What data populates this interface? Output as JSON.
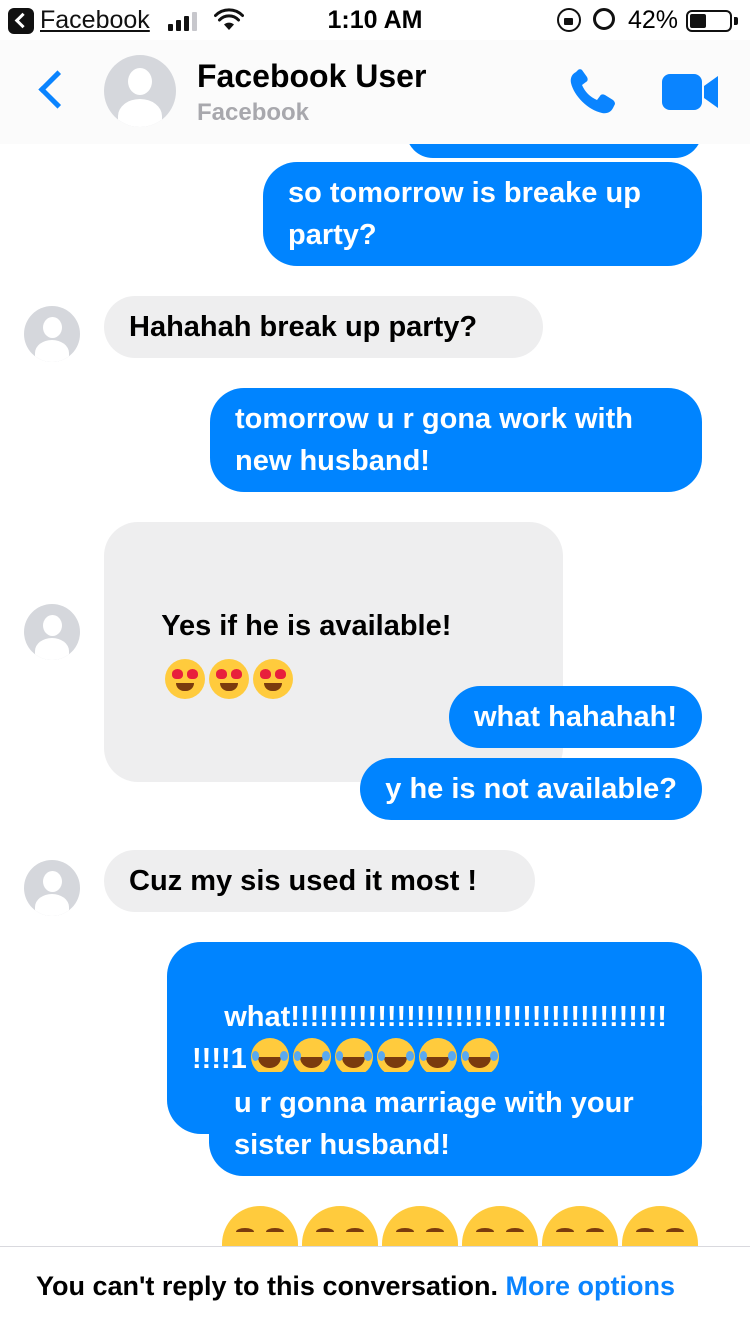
{
  "status_bar": {
    "back_app": "Facebook",
    "time": "1:10 AM",
    "battery_percent": "42%",
    "battery_level": 0.42,
    "signal_bars": 3,
    "icons": [
      "signal-icon",
      "wifi-icon",
      "orientation-lock-icon",
      "alarm-icon",
      "battery-icon"
    ]
  },
  "header": {
    "contact_name": "Facebook User",
    "contact_subtitle": "Facebook",
    "icons": [
      "back-chevron-icon",
      "avatar-icon",
      "phone-icon",
      "video-camera-icon"
    ],
    "accent_color": "#0a84ff"
  },
  "messages": [
    {
      "direction": "outgoing",
      "text": "so tomorrow is breake up\nparty?"
    },
    {
      "direction": "incoming",
      "text": "Hahahah break up party?"
    },
    {
      "direction": "outgoing",
      "text": "tomorrow u r gona work with\nnew husband!"
    },
    {
      "direction": "incoming",
      "text": "Yes if he is available!",
      "emoji": [
        "heart-eyes",
        "heart-eyes",
        "heart-eyes"
      ]
    },
    {
      "direction": "outgoing",
      "text": "what hahahah!"
    },
    {
      "direction": "outgoing",
      "text": "y he is not available?"
    },
    {
      "direction": "incoming",
      "text": "Cuz my sis used it most !"
    },
    {
      "direction": "outgoing",
      "text": "what!!!!!!!!!!!!!!!!!!!!!!!!!!!!!!!!!!!!!!!\n!!!!1",
      "emoji": [
        "tears-of-joy",
        "tears-of-joy",
        "tears-of-joy",
        "tears-of-joy",
        "tears-of-joy",
        "tears-of-joy"
      ]
    },
    {
      "direction": "outgoing",
      "text": "u r gonna marriage with your\nsister husband!"
    },
    {
      "direction": "outgoing",
      "emoji_only": [
        "tears-of-joy",
        "tears-of-joy",
        "tears-of-joy",
        "tears-of-joy",
        "tears-of-joy",
        "tears-of-joy"
      ]
    }
  ],
  "colors": {
    "outgoing_bubble": "#0084ff",
    "incoming_bubble": "#eeeeef"
  },
  "footer": {
    "notice": "You can't reply to this conversation.",
    "link": "More options"
  }
}
